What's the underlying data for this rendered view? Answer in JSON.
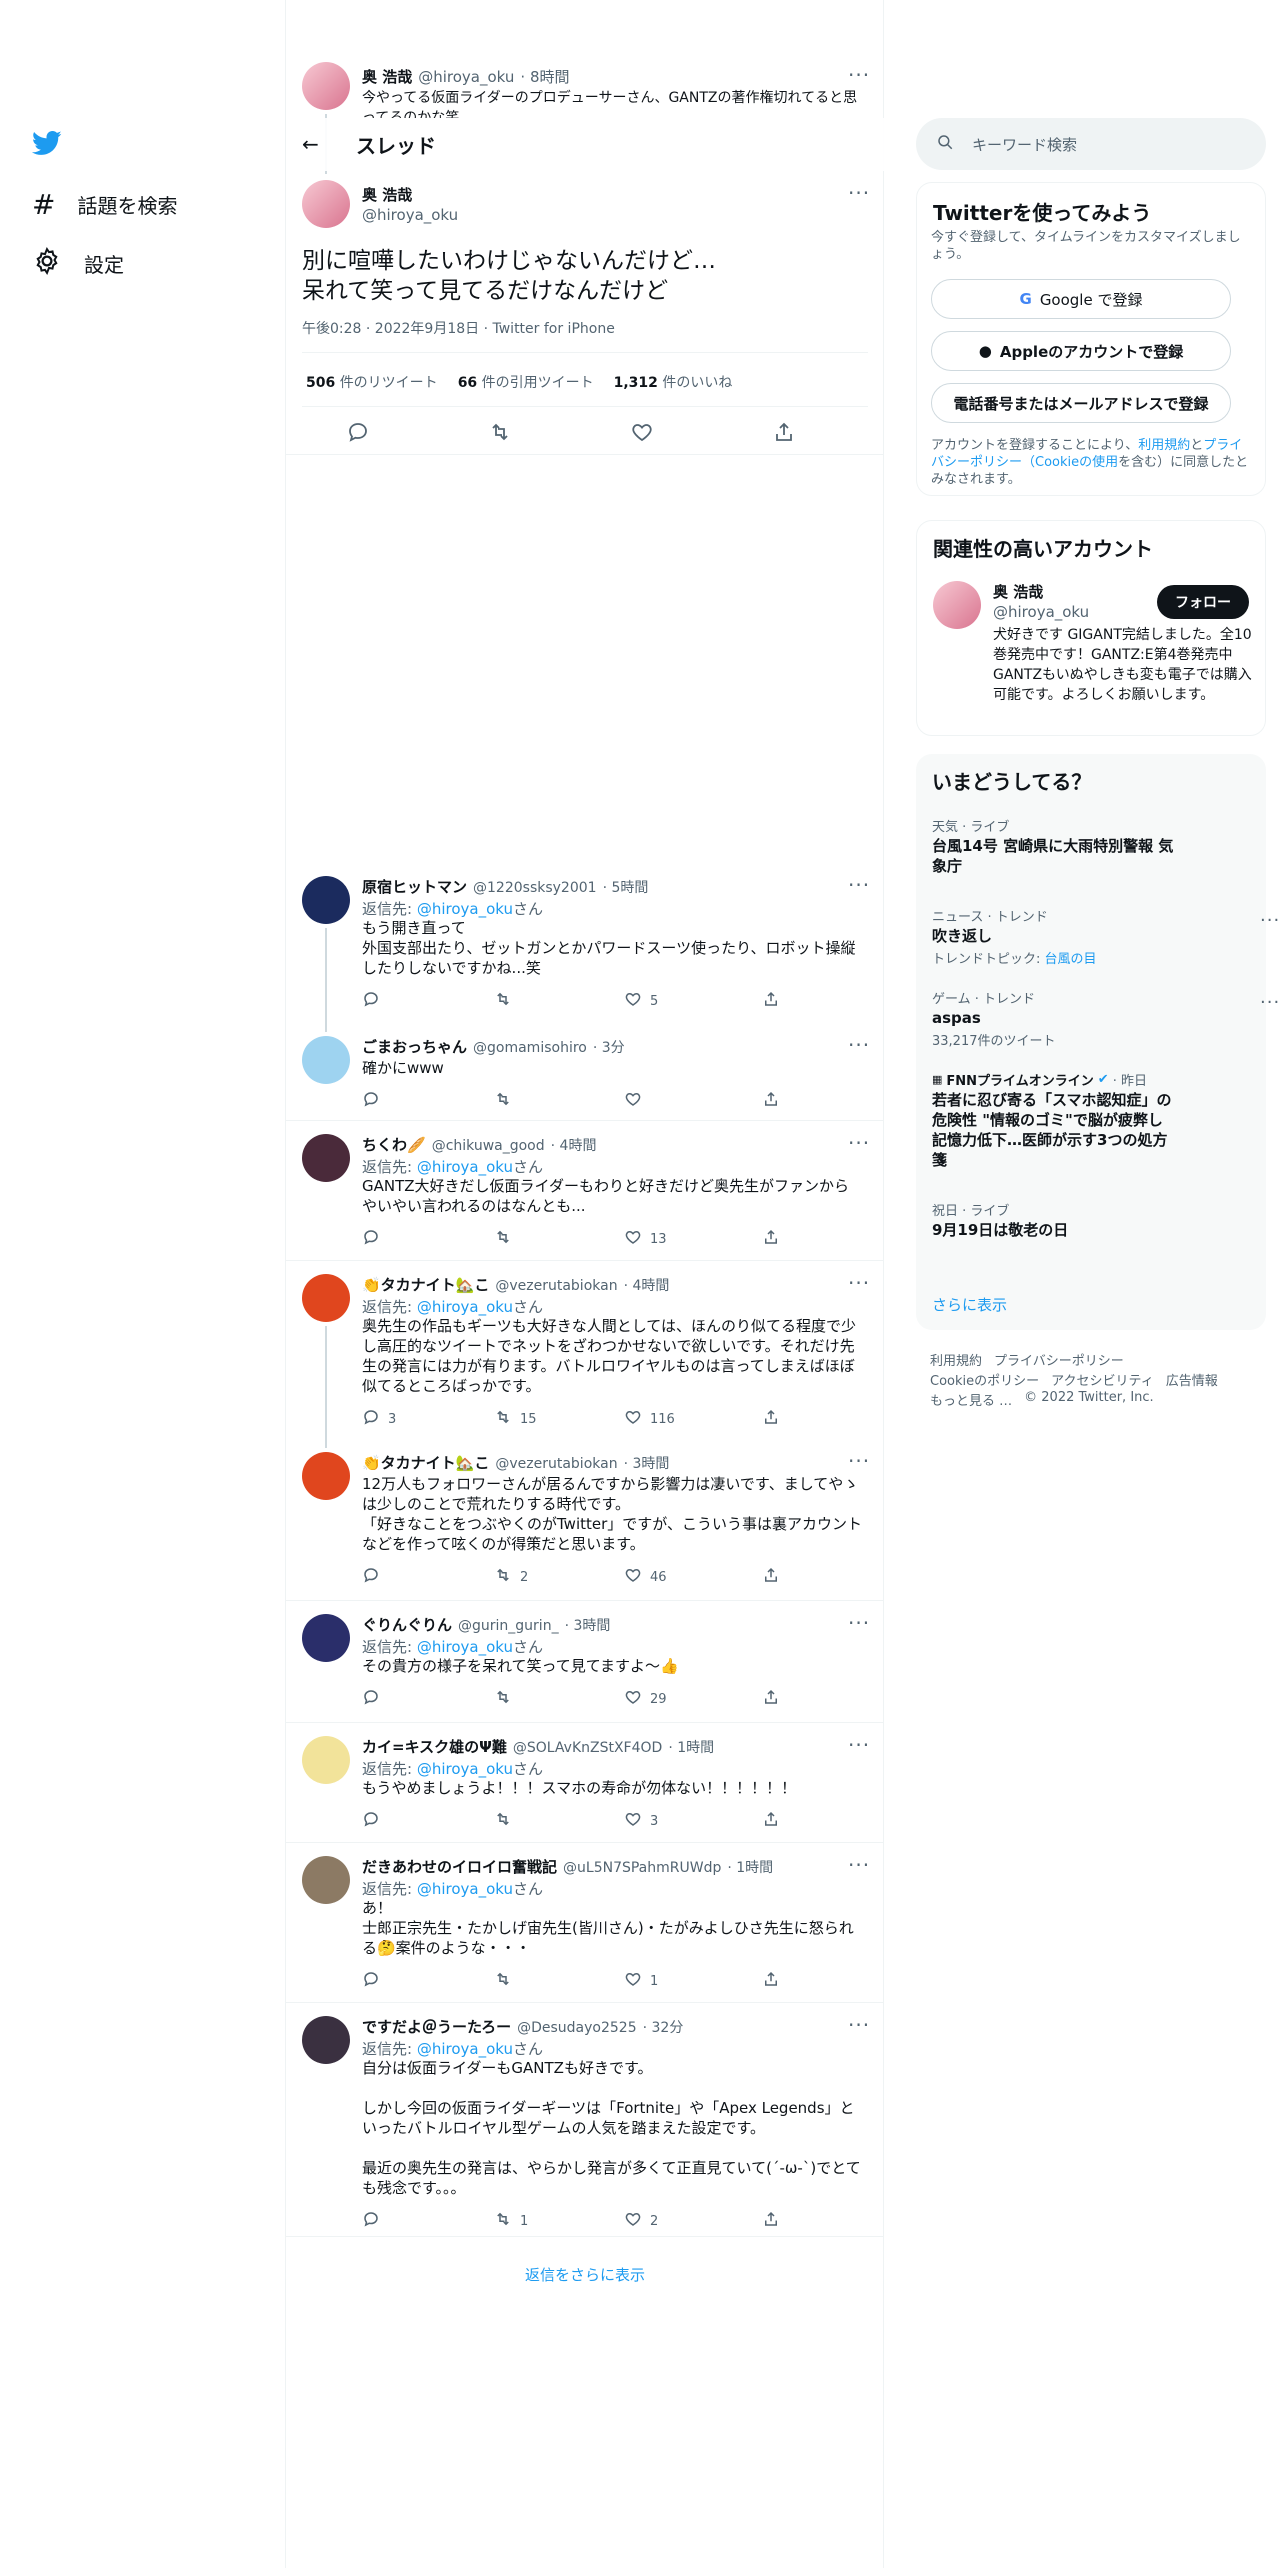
{
  "nav": {
    "explore": "話題を検索",
    "settings": "設定"
  },
  "top_tweet": {
    "name": "奥 浩哉",
    "handle": "@hiroya_oku",
    "time": "· 8時間",
    "text": "今やってる仮面ライダーのプロデューサーさん、GANTZの著作権切れてると思ってるのかな笑"
  },
  "header": {
    "title": "スレッド"
  },
  "main_tweet": {
    "name": "奥 浩哉",
    "handle": "@hiroya_oku",
    "text": "別に喧嘩したいわけじゃないんだけど…\n呆れて笑って見てるだけなんだけど",
    "meta": "午後0:28 · 2022年9月18日 · Twitter for iPhone",
    "retweets_num": "506",
    "retweets_label": "件のリツイート",
    "quotes_num": "66",
    "quotes_label": "件の引用ツイート",
    "likes_num": "1,312",
    "likes_label": "件のいいね"
  },
  "replies": [
    {
      "name": "原宿ヒットマン",
      "handle": "@1220ssksy2001",
      "time": "· 5時間",
      "replying_prefix": "返信先: ",
      "replying_to": "@hiroya_oku",
      "replying_suffix": "さん",
      "text": "もう開き直って\n外国支部出たり、ゼットガンとかパワードスーツ使ったり、ロボット操縦したりしないですかね...笑",
      "replies": "",
      "retweets": "",
      "likes": "5"
    },
    {
      "name": "ごまおっちゃん",
      "handle": "@gomamisohiro",
      "time": "· 3分",
      "text": "確かにwww",
      "replies": "",
      "retweets": "",
      "likes": ""
    },
    {
      "name": "ちくわ🥖",
      "handle": "@chikuwa_good",
      "time": "· 4時間",
      "replying_prefix": "返信先: ",
      "replying_to": "@hiroya_oku",
      "replying_suffix": "さん",
      "text": "GANTZ大好きだし仮面ライダーもわりと好きだけど奥先生がファンからやいやい言われるのはなんとも...",
      "replies": "",
      "retweets": "",
      "likes": "13"
    },
    {
      "name": "👏タカナイト🏡こ",
      "handle": "@vezerutabiokan",
      "time": "· 4時間",
      "replying_prefix": "返信先: ",
      "replying_to": "@hiroya_oku",
      "replying_suffix": "さん",
      "text": "奥先生の作品もギーツも大好きな人間としては、ほんのり似てる程度で少し高圧的なツイートでネットをざわつかせないで欲しいです。それだけ先生の発言には力が有ります。バトルロワイヤルものは言ってしまえばほぼ似てるところばっかです。",
      "replies": "3",
      "retweets": "15",
      "likes": "116"
    },
    {
      "name": "👏タカナイト🏡こ",
      "handle": "@vezerutabiokan",
      "time": "· 3時間",
      "text": "12万人もフォロワーさんが居るんですから影響力は凄いです、ましてやゝは少しのことで荒れたりする時代です。\n「好きなことをつぶやくのがTwitter」ですが、こういう事は裏アカウントなどを作って呟くのが得策だと思います。",
      "replies": "",
      "retweets": "2",
      "likes": "46"
    },
    {
      "name": "ぐりんぐりん",
      "handle": "@gurin_gurin_",
      "time": "· 3時間",
      "replying_prefix": "返信先: ",
      "replying_to": "@hiroya_oku",
      "replying_suffix": "さん",
      "text": "その貴方の様子を呆れて笑って見てますよ〜👍",
      "replies": "",
      "retweets": "",
      "likes": "29"
    },
    {
      "name": "カイ=キスク雄のΨ難",
      "handle": "@SOLAvKnZStXF4OD",
      "time": "· 1時間",
      "replying_prefix": "返信先: ",
      "replying_to": "@hiroya_oku",
      "replying_suffix": "さん",
      "text": "もうやめましょうよ！！！スマホの寿命が勿体ない！！！！！！",
      "replies": "",
      "retweets": "",
      "likes": "3"
    },
    {
      "name": "だきあわせのイロイロ奮戦記",
      "handle": "@uL5N7SPahmRUWdp",
      "time": "· 1時間",
      "replying_prefix": "返信先: ",
      "replying_to": "@hiroya_oku",
      "replying_suffix": "さん",
      "text": "あ！\n士郎正宗先生・たかしげ宙先生(皆川さん)・たがみよしひさ先生に怒られる🤔案件のような・・・",
      "replies": "",
      "retweets": "",
      "likes": "1"
    },
    {
      "name": "ですだよ＠うーたろー",
      "handle": "@Desudayo2525",
      "time": "· 32分",
      "replying_prefix": "返信先: ",
      "replying_to": "@hiroya_oku",
      "replying_suffix": "さん",
      "text": "自分は仮面ライダーもGANTZも好きです。\n\nしかし今回の仮面ライダーギーツは「Fortnite」や「Apex Legends」といったバトルロイヤル型ゲームの人気を踏まえた設定です。\n\n最近の奥先生の発言は、やらかし発言が多くて正直見ていて(´-ω-`)でとても残念です。。。",
      "replies": "",
      "retweets": "1",
      "likes": "2"
    }
  ],
  "show_more_replies": "返信をさらに表示",
  "search": {
    "placeholder": "キーワード検索"
  },
  "signup": {
    "title": "Twitterを使ってみよう",
    "desc": "今すぐ登録して、タイムラインをカスタマイズしましょう。",
    "google": "Google で登録",
    "apple": "Appleのアカウントで登録",
    "phone": "電話番号またはメールアドレスで登録",
    "terms_1": "アカウントを登録することにより、",
    "terms_link1": "利用規約",
    "terms_2": "と",
    "terms_link2": "プライバシーポリシー（Cookieの使用",
    "terms_3": "を含む）に同意したとみなされます。"
  },
  "related": {
    "title": "関連性の高いアカウント",
    "name": "奥 浩哉",
    "handle": "@hiroya_oku",
    "follow": "フォロー",
    "bio": "犬好きです GIGANT完結しました。全10巻発売中です！GANTZ:E第4巻発売中GANTZもいぬやしきも変も電子では購入可能です。よろしくお願いします。"
  },
  "trends": {
    "title": "いまどうしてる？",
    "items": [
      {
        "category": "天気 · ライブ",
        "name": "台風14号 宮崎県に大雨特別警報 気象庁",
        "sub": ""
      },
      {
        "category": "ニュース · トレンド",
        "name": "吹き返し",
        "sub_prefix": "トレンドトピック: ",
        "sub_link": "台風の目"
      },
      {
        "category": "ゲーム · トレンド",
        "name": "aspas",
        "sub": "33,217件のツイート"
      },
      {
        "category": "FNNプライムオンライン",
        "category_time": "· 昨日",
        "name": "若者に忍び寄る「スマホ認知症」の危険性 \"情報のゴミ\"で脳が疲弊し記憶力低下…医師が示す3つの処方箋",
        "sub": ""
      },
      {
        "category": "祝日 · ライブ",
        "name": "9月19日は敬老の日",
        "sub": ""
      }
    ],
    "show_more": "さらに表示"
  },
  "footer": {
    "terms": "利用規約",
    "privacy": "プライバシーポリシー",
    "cookie": "Cookieのポリシー",
    "accessibility": "アクセシビリティ",
    "ads": "広告情報",
    "more": "もっと見る …",
    "copyright": "© 2022 Twitter, Inc."
  },
  "colors": {
    "accent": "#1d9bf0",
    "text": "#0f1419",
    "muted": "#536471",
    "border": "#eff3f4"
  }
}
